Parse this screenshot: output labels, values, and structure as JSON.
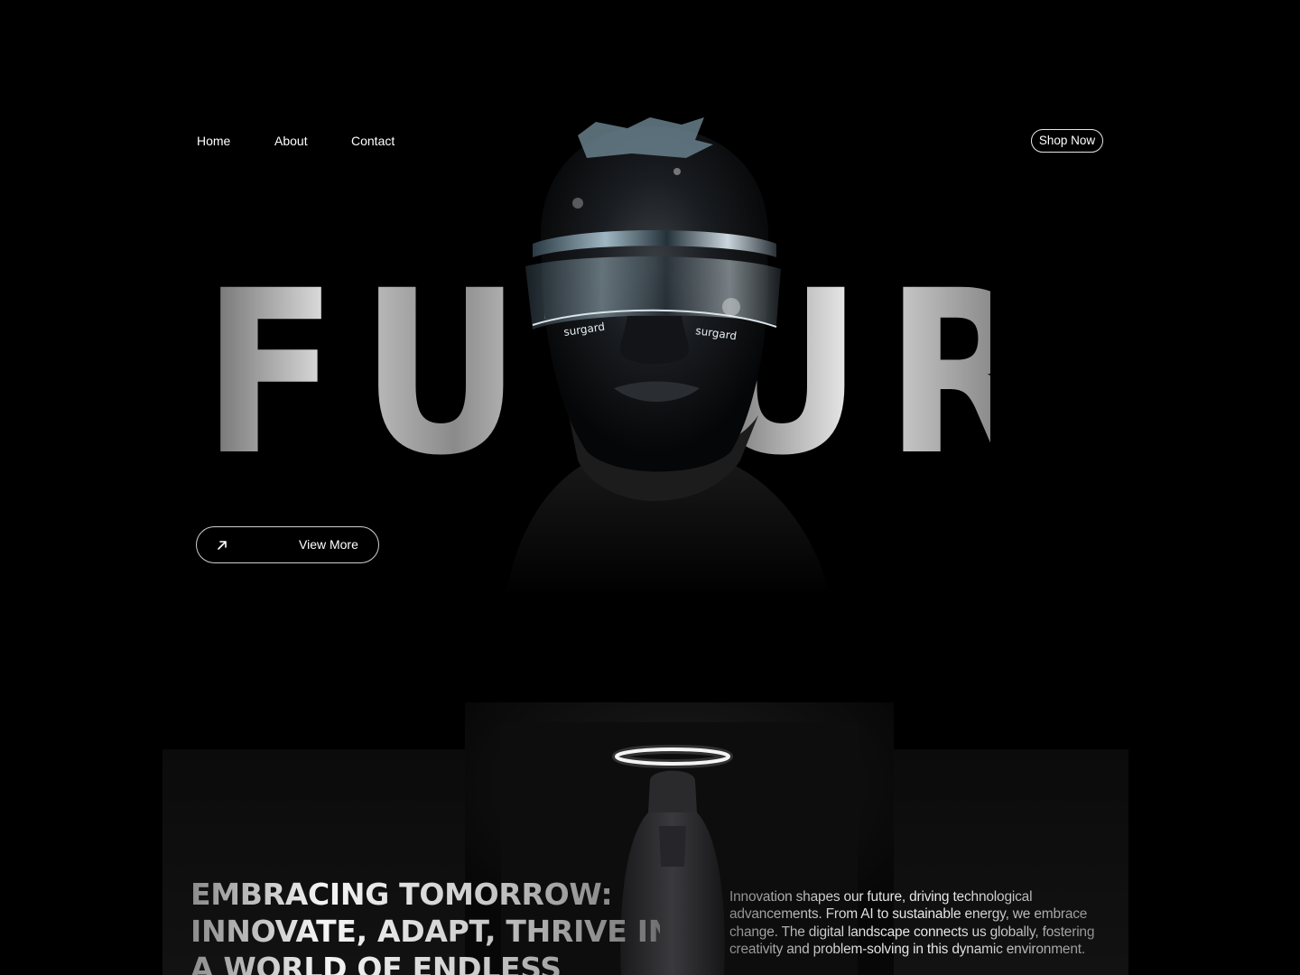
{
  "nav": {
    "items": [
      {
        "label": "Home"
      },
      {
        "label": "About"
      },
      {
        "label": "Contact"
      }
    ],
    "cta_label": "Shop Now"
  },
  "hero": {
    "word": "FUTURE",
    "portrait_visor_text": "surgard",
    "view_more_label": "View More",
    "arrow_icon": "arrow-up-right-icon"
  },
  "section2": {
    "headline_lines": [
      "EMBRACING TOMORROW:",
      "INNOVATE, ADAPT, THRIVE IN",
      "A WORLD OF ENDLESS"
    ],
    "paragraph": "Innovation shapes our future, driving technological advancements. From AI to sustainable energy, we embrace change. The digital landscape connects us globally, fostering creativity and problem-solving in this dynamic environment."
  },
  "colors": {
    "background": "#000000",
    "text": "#ffffff",
    "halo": "#f2f2f2"
  }
}
